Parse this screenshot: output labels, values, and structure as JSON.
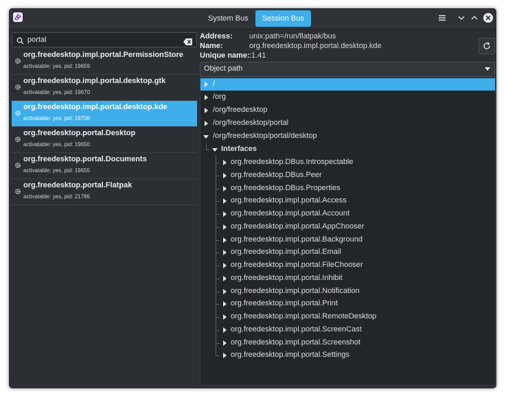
{
  "header": {
    "tabs": [
      {
        "label": "System Bus",
        "active": false
      },
      {
        "label": "Session Bus",
        "active": true
      }
    ],
    "menu_icon": "hamburger-menu-icon",
    "minimize_icon": "chevron-down-icon",
    "maximize_icon": "chevron-up-icon",
    "close_icon": "close-icon"
  },
  "search": {
    "value": "portal"
  },
  "services": [
    {
      "name": "org.freedesktop.impl.portal.PermissionStore",
      "meta": "activatable: yes, pid: 19659",
      "selected": false
    },
    {
      "name": "org.freedesktop.impl.portal.desktop.gtk",
      "meta": "activatable: yes, pid: 19670",
      "selected": false
    },
    {
      "name": "org.freedesktop.impl.portal.desktop.kde",
      "meta": "activatable: yes, pid: 19706",
      "selected": true
    },
    {
      "name": "org.freedesktop.portal.Desktop",
      "meta": "activatable: yes, pid: 19650",
      "selected": false
    },
    {
      "name": "org.freedesktop.portal.Documents",
      "meta": "activatable: yes, pid: 19655",
      "selected": false
    },
    {
      "name": "org.freedesktop.portal.Flatpak",
      "meta": "activatable: yes, pid: 21786",
      "selected": false
    }
  ],
  "info": {
    "address_label": "Address:",
    "address_value": "unix:path=/run/flatpak/bus",
    "name_label": "Name:",
    "name_value": "org.freedesktop.impl.portal.desktop.kde",
    "unique_label": "Unique name:",
    "unique_value": ":1.41"
  },
  "combo": {
    "selected": "Object path"
  },
  "tree": {
    "paths": [
      {
        "label": "/",
        "selected": true,
        "expanded": false
      },
      {
        "label": "/org",
        "selected": false,
        "expanded": false
      },
      {
        "label": "/org/freedesktop",
        "selected": false,
        "expanded": false
      },
      {
        "label": "/org/freedesktop/portal",
        "selected": false,
        "expanded": false
      },
      {
        "label": "/org/freedesktop/portal/desktop",
        "selected": false,
        "expanded": true
      }
    ],
    "interfaces_label": "Interfaces",
    "interfaces": [
      "org.freedesktop.DBus.Introspectable",
      "org.freedesktop.DBus.Peer",
      "org.freedesktop.DBus.Properties",
      "org.freedesktop.impl.portal.Access",
      "org.freedesktop.impl.portal.Account",
      "org.freedesktop.impl.portal.AppChooser",
      "org.freedesktop.impl.portal.Background",
      "org.freedesktop.impl.portal.Email",
      "org.freedesktop.impl.portal.FileChooser",
      "org.freedesktop.impl.portal.Inhibit",
      "org.freedesktop.impl.portal.Notification",
      "org.freedesktop.impl.portal.Print",
      "org.freedesktop.impl.portal.RemoteDesktop",
      "org.freedesktop.impl.portal.ScreenCast",
      "org.freedesktop.impl.portal.Screenshot",
      "org.freedesktop.impl.portal.Settings"
    ]
  },
  "colors": {
    "accent": "#3daee9",
    "window_bg": "#2b2f33",
    "tree_bg": "#232629"
  }
}
